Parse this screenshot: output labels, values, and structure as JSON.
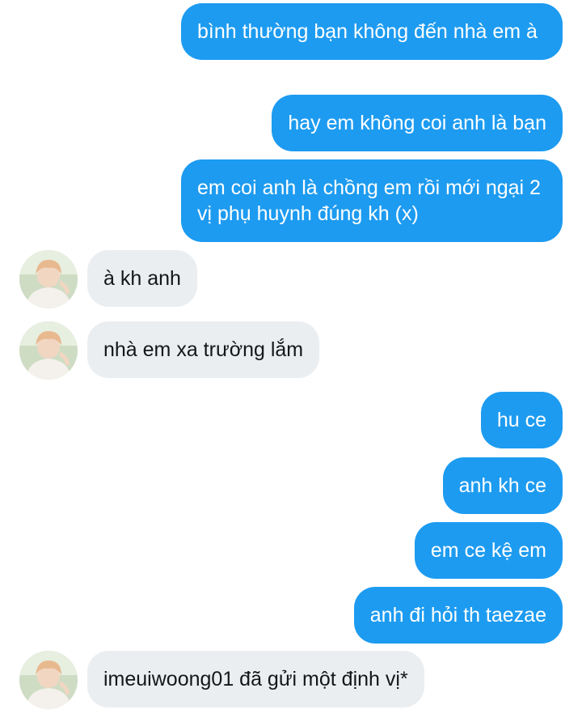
{
  "conversation": {
    "messages": [
      {
        "id": "m1",
        "direction": "outgoing",
        "text": "bình thường bạn không đến nhà em à"
      },
      {
        "id": "m2",
        "direction": "outgoing",
        "text": "hay em không coi anh là bạn"
      },
      {
        "id": "m3",
        "direction": "outgoing",
        "text": "em coi anh là chồng em rồi mới ngại 2 vị phụ huynh đúng kh (x)"
      },
      {
        "id": "m4",
        "direction": "incoming",
        "text": "à kh anh"
      },
      {
        "id": "m5",
        "direction": "incoming",
        "text": "nhà em xa trường lắm"
      },
      {
        "id": "m6",
        "direction": "outgoing",
        "text": "hu ce"
      },
      {
        "id": "m7",
        "direction": "outgoing",
        "text": "anh kh ce"
      },
      {
        "id": "m8",
        "direction": "outgoing",
        "text": "em ce kệ em"
      },
      {
        "id": "m9",
        "direction": "outgoing",
        "text": "anh đi hỏi th taezae"
      },
      {
        "id": "m10",
        "direction": "incoming",
        "text": "imeuiwoong01 đã gửi một định vị*"
      }
    ]
  },
  "colors": {
    "outgoing_bubble": "#1d9bf0",
    "outgoing_text": "#ffffff",
    "incoming_bubble": "#ebeef1",
    "incoming_text": "#14171a",
    "background": "#ffffff"
  },
  "icons": {
    "avatar": "contact-avatar-icon"
  }
}
